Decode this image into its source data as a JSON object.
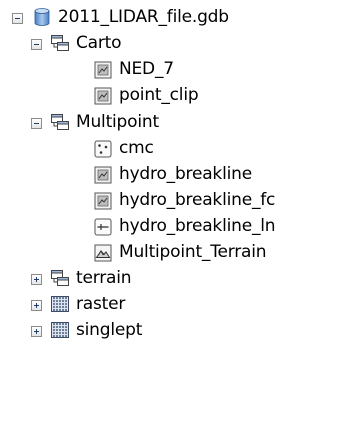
{
  "tree": {
    "root": {
      "label": "2011_LIDAR_file.gdb",
      "expanded": true,
      "icon": "geodatabase-icon"
    },
    "carto": {
      "label": "Carto",
      "expanded": true,
      "icon": "feature-dataset-icon",
      "children": [
        {
          "label": "NED_7",
          "icon": "raster-dataset-icon"
        },
        {
          "label": "point_clip",
          "icon": "raster-dataset-icon"
        }
      ]
    },
    "multipoint": {
      "label": "Multipoint",
      "expanded": true,
      "icon": "feature-dataset-icon",
      "children": [
        {
          "label": "cmc",
          "icon": "point-feature-class-icon"
        },
        {
          "label": "hydro_breakline",
          "icon": "raster-dataset-icon"
        },
        {
          "label": "hydro_breakline_fc",
          "icon": "raster-dataset-icon"
        },
        {
          "label": "hydro_breakline_ln",
          "icon": "line-feature-class-icon"
        },
        {
          "label": "Multipoint_Terrain",
          "icon": "terrain-icon"
        }
      ]
    },
    "terrain": {
      "label": "terrain",
      "expanded": false,
      "icon": "feature-dataset-icon"
    },
    "raster": {
      "label": "raster",
      "expanded": false,
      "icon": "raster-catalog-icon"
    },
    "singlept": {
      "label": "singlept",
      "expanded": false,
      "icon": "raster-catalog-icon"
    }
  }
}
